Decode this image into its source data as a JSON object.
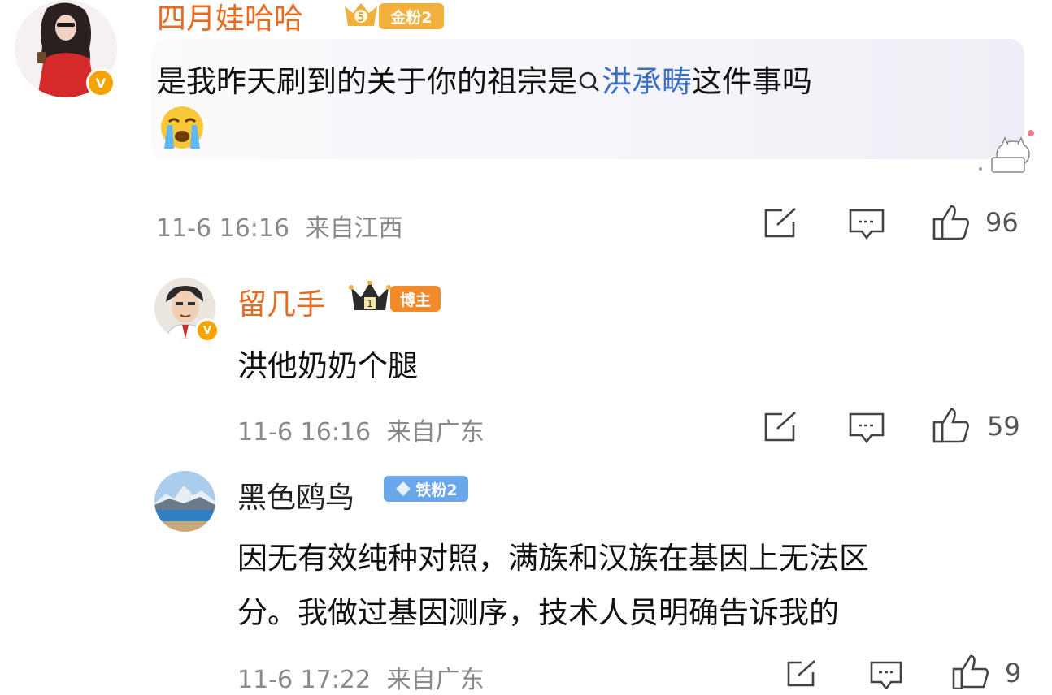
{
  "comments": [
    {
      "username": "四月娃哈哈",
      "fan_badge": "金粉2",
      "fan_badge_level": "5",
      "text_before": "是我昨天刷到的关于你的祖宗是",
      "link": "洪承畴",
      "text_after": "这件事吗",
      "emoji": "crying-face",
      "time": "11-6 16:16",
      "location": "来自江西",
      "likes": "96"
    },
    {
      "username": "留几手",
      "crown_level": "1",
      "role_badge": "博主",
      "text": "洪他奶奶个腿",
      "time": "11-6 16:16",
      "location": "来自广东",
      "likes": "59"
    },
    {
      "username": "黑色鸥鸟",
      "fan_badge": "铁粉2",
      "line1": "因无有效纯种对照，满族和汉族在基因上无法区",
      "line2": "分。我做过基因测序，技术人员明确告诉我的",
      "time": "11-6 17:22",
      "location": "来自广东",
      "likes": "9"
    }
  ],
  "colors": {
    "username_orange": "#e96b1f",
    "link_blue": "#3b6fc4",
    "meta_gray": "#8a8a8a",
    "gold_badge": "#f2b13c",
    "blogger_badge": "#f08a2a",
    "iron_badge": "#6aa6ea",
    "verified": "#f5a300"
  },
  "icons": {
    "share": "share-icon",
    "comment": "comment-icon",
    "like": "thumbs-up-icon",
    "search": "search-icon",
    "verified": "verified-v-icon"
  }
}
